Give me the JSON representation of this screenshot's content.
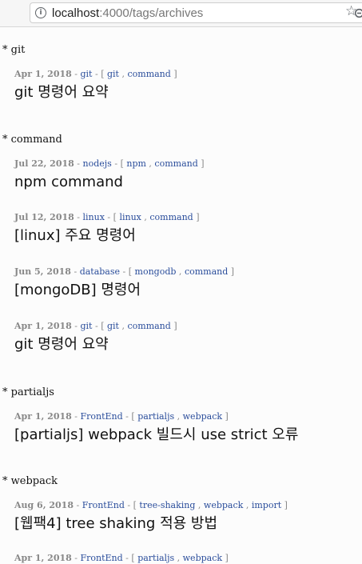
{
  "browser": {
    "url_host": "localhost",
    "url_path": ":4000/tags/archives",
    "info_icon": "info-icon",
    "zoom_icon": "magnifier-minus-icon",
    "star_icon": "bookmark-star-icon"
  },
  "colors": {
    "link": "#2a4d9b",
    "meta": "#888888",
    "title": "#111111"
  },
  "sections": [
    {
      "heading": "* git",
      "posts": [
        {
          "date": "Apr 1, 2018",
          "dash1": " - ",
          "category": "git",
          "dash2": " - ",
          "open": "[ ",
          "tags": [
            "git",
            "command"
          ],
          "close": " ]",
          "title": "git 명령어 요약"
        }
      ]
    },
    {
      "heading": "* command",
      "posts": [
        {
          "date": "Jul 22, 2018",
          "dash1": " - ",
          "category": "nodejs",
          "dash2": " - ",
          "open": "[ ",
          "tags": [
            "npm",
            "command"
          ],
          "close": " ]",
          "title": "npm command"
        },
        {
          "date": "Jul 12, 2018",
          "dash1": " - ",
          "category": "linux",
          "dash2": " - ",
          "open": "[ ",
          "tags": [
            "linux",
            "command"
          ],
          "close": " ]",
          "title": "[linux] 주요 명령어"
        },
        {
          "date": "Jun 5, 2018",
          "dash1": " - ",
          "category": "database",
          "dash2": " - ",
          "open": "[ ",
          "tags": [
            "mongodb",
            "command"
          ],
          "close": " ]",
          "title": "[mongoDB] 명령어"
        },
        {
          "date": "Apr 1, 2018",
          "dash1": " - ",
          "category": "git",
          "dash2": " - ",
          "open": "[ ",
          "tags": [
            "git",
            "command"
          ],
          "close": " ]",
          "title": "git 명령어 요약"
        }
      ]
    },
    {
      "heading": "* partialjs",
      "posts": [
        {
          "date": "Apr 1, 2018",
          "dash1": " - ",
          "category": "FrontEnd",
          "dash2": " - ",
          "open": "[ ",
          "tags": [
            "partialjs",
            "webpack"
          ],
          "close": " ]",
          "title": "[partialjs] webpack 빌드시 use strict 오류"
        }
      ]
    },
    {
      "heading": "* webpack",
      "posts": [
        {
          "date": "Aug 6, 2018",
          "dash1": " - ",
          "category": "FrontEnd",
          "dash2": " - ",
          "open": "[ ",
          "tags": [
            "tree-shaking",
            "webpack",
            "import"
          ],
          "close": " ]",
          "title": "[웹팩4] tree shaking 적용 방법"
        },
        {
          "date": "Apr 1, 2018",
          "dash1": " - ",
          "category": "FrontEnd",
          "dash2": " - ",
          "open": "[ ",
          "tags": [
            "partialjs",
            "webpack"
          ],
          "close": " ]",
          "title": ""
        }
      ]
    }
  ]
}
